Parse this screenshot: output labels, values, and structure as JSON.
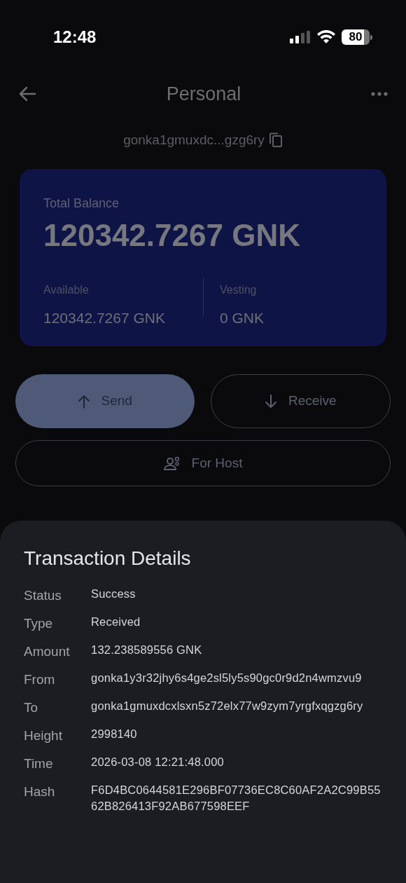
{
  "status_bar": {
    "time": "12:48",
    "battery": "80"
  },
  "header": {
    "title": "Personal"
  },
  "address": "gonka1gmuxdc...gzg6ry",
  "balance_card": {
    "total_label": "Total Balance",
    "total": "120342.7267 GNK",
    "available_label": "Available",
    "available": "120342.7267 GNK",
    "vesting_label": "Vesting",
    "vesting": "0 GNK"
  },
  "actions": [
    {
      "kind": "send",
      "label": "Send"
    },
    {
      "kind": "receive",
      "label": "Receive"
    },
    {
      "kind": "host",
      "label": "For Host"
    }
  ],
  "sheet": {
    "title": "Transaction Details",
    "rows": [
      {
        "label": "Status",
        "value": "Success"
      },
      {
        "label": "Type",
        "value": "Received"
      },
      {
        "label": "Amount",
        "value": "132.238589556 GNK"
      },
      {
        "label": "From",
        "value": "gonka1y3r32jhy6s4ge2sl5ly5s90gc0r9d2n4wmzvu9"
      },
      {
        "label": "To",
        "value": "gonka1gmuxdcxlsxn5z72elx77w9zym7yrgfxqgzg6ry"
      },
      {
        "label": "Height",
        "value": "2998140"
      },
      {
        "label": "Time",
        "value": "2026-03-08 12:21:48.000"
      },
      {
        "label": "Hash",
        "value": "F6D4BC0644581E296BF07736EC8C60AF2A2C99B5562B826413F92AB677598EEF"
      }
    ]
  }
}
